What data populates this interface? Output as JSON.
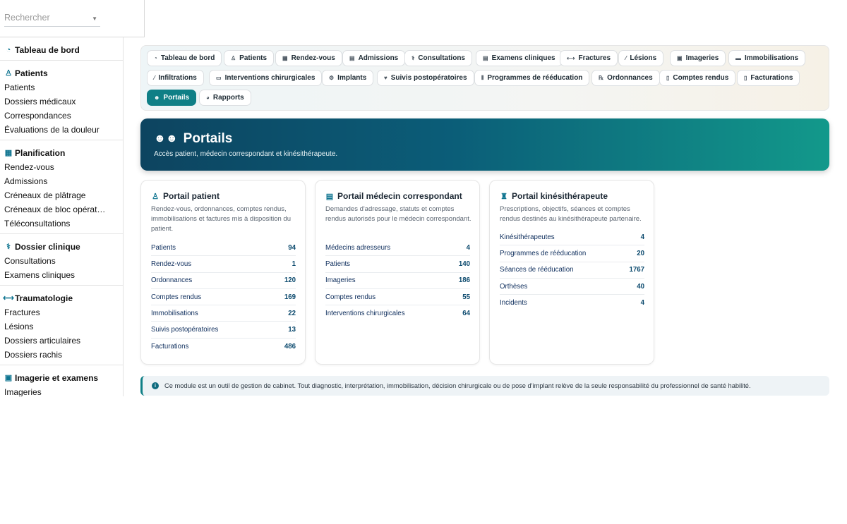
{
  "search": {
    "placeholder": "Rechercher"
  },
  "sidebar": {
    "groups": [
      {
        "title": "Tableau de bord",
        "icon": "gauge-icon",
        "items": []
      },
      {
        "title": "Patients",
        "icon": "user-doctor-icon",
        "items": [
          "Patients",
          "Dossiers médicaux",
          "Correspondances",
          "Évaluations de la douleur"
        ]
      },
      {
        "title": "Planification",
        "icon": "calendar-icon",
        "items": [
          "Rendez-vous",
          "Admissions",
          "Créneaux de plâtrage",
          "Créneaux de bloc opérat…",
          "Téléconsultations"
        ]
      },
      {
        "title": "Dossier clinique",
        "icon": "stethoscope-icon",
        "items": [
          "Consultations",
          "Examens cliniques"
        ]
      },
      {
        "title": "Traumatologie",
        "icon": "bone-icon",
        "items": [
          "Fractures",
          "Lésions",
          "Dossiers articulaires",
          "Dossiers rachis"
        ]
      },
      {
        "title": "Imagerie et examens",
        "icon": "x-ray-icon",
        "items": [
          "Imageries"
        ]
      }
    ]
  },
  "tabs": [
    {
      "label": "Tableau de bord",
      "icon": "gauge-icon"
    },
    {
      "label": "Patients",
      "icon": "user-doctor-icon"
    },
    {
      "label": "Rendez-vous",
      "icon": "calendar-icon"
    },
    {
      "label": "Admissions",
      "icon": "clipboard-icon"
    },
    {
      "label": "Consultations",
      "icon": "stethoscope-icon"
    },
    {
      "label": "Examens cliniques",
      "icon": "clipboard-list-icon"
    },
    {
      "label": "Fractures",
      "icon": "bone-icon"
    },
    {
      "label": "Lésions",
      "icon": "bandage-icon"
    },
    {
      "label": "Imageries",
      "icon": "x-ray-icon"
    },
    {
      "label": "Immobilisations",
      "icon": "splint-icon"
    },
    {
      "label": "Infiltrations",
      "icon": "syringe-icon"
    },
    {
      "label": "Interventions chirurgicales",
      "icon": "bed-icon"
    },
    {
      "label": "Implants",
      "icon": "gears-icon"
    },
    {
      "label": "Suivis postopératoires",
      "icon": "heart-icon"
    },
    {
      "label": "Programmes de rééducation",
      "icon": "dumbbell-icon"
    },
    {
      "label": "Ordonnances",
      "icon": "prescription-icon"
    },
    {
      "label": "Comptes rendus",
      "icon": "file-icon"
    },
    {
      "label": "Facturations",
      "icon": "invoice-icon"
    },
    {
      "label": "Portails",
      "icon": "users-icon",
      "active": true
    },
    {
      "label": "Rapports",
      "icon": "pie-chart-icon"
    }
  ],
  "hero": {
    "title": "Portails",
    "subtitle": "Accès patient, médecin correspondant et kinésithérapeute."
  },
  "cards": [
    {
      "title": "Portail patient",
      "icon": "user-doctor-icon",
      "description": "Rendez-vous, ordonnances, comptes rendus, immobilisations et factures mis à disposition du patient.",
      "rows": [
        {
          "label": "Patients",
          "value": "94"
        },
        {
          "label": "Rendez-vous",
          "value": "1"
        },
        {
          "label": "Ordonnances",
          "value": "120"
        },
        {
          "label": "Comptes rendus",
          "value": "169"
        },
        {
          "label": "Immobilisations",
          "value": "22"
        },
        {
          "label": "Suivis postopératoires",
          "value": "13"
        },
        {
          "label": "Facturations",
          "value": "486"
        }
      ]
    },
    {
      "title": "Portail médecin correspondant",
      "icon": "id-card-icon",
      "description": "Demandes d'adressage, statuts et comptes rendus autorisés pour le médecin correspondant.",
      "rows": [
        {
          "label": "Médecins adresseurs",
          "value": "4"
        },
        {
          "label": "Patients",
          "value": "140"
        },
        {
          "label": "Imageries",
          "value": "186"
        },
        {
          "label": "Comptes rendus",
          "value": "55"
        },
        {
          "label": "Interventions chirurgicales",
          "value": "64"
        }
      ]
    },
    {
      "title": "Portail kinésithérapeute",
      "icon": "walking-icon",
      "description": "Prescriptions, objectifs, séances et comptes rendus destinés au kinésithérapeute partenaire.",
      "rows": [
        {
          "label": "Kinésithérapeutes",
          "value": "4"
        },
        {
          "label": "Programmes de rééducation",
          "value": "20"
        },
        {
          "label": "Séances de rééducation",
          "value": "1767"
        },
        {
          "label": "Orthèses",
          "value": "40"
        },
        {
          "label": "Incidents",
          "value": "4"
        }
      ]
    }
  ],
  "notice": {
    "icon": "info-icon",
    "text": "Ce module est un outil de gestion de cabinet. Tout diagnostic, interprétation, immobilisation, décision chirurgicale ou de pose d'implant relève de la seule responsabilité du professionnel de santé habilité."
  }
}
